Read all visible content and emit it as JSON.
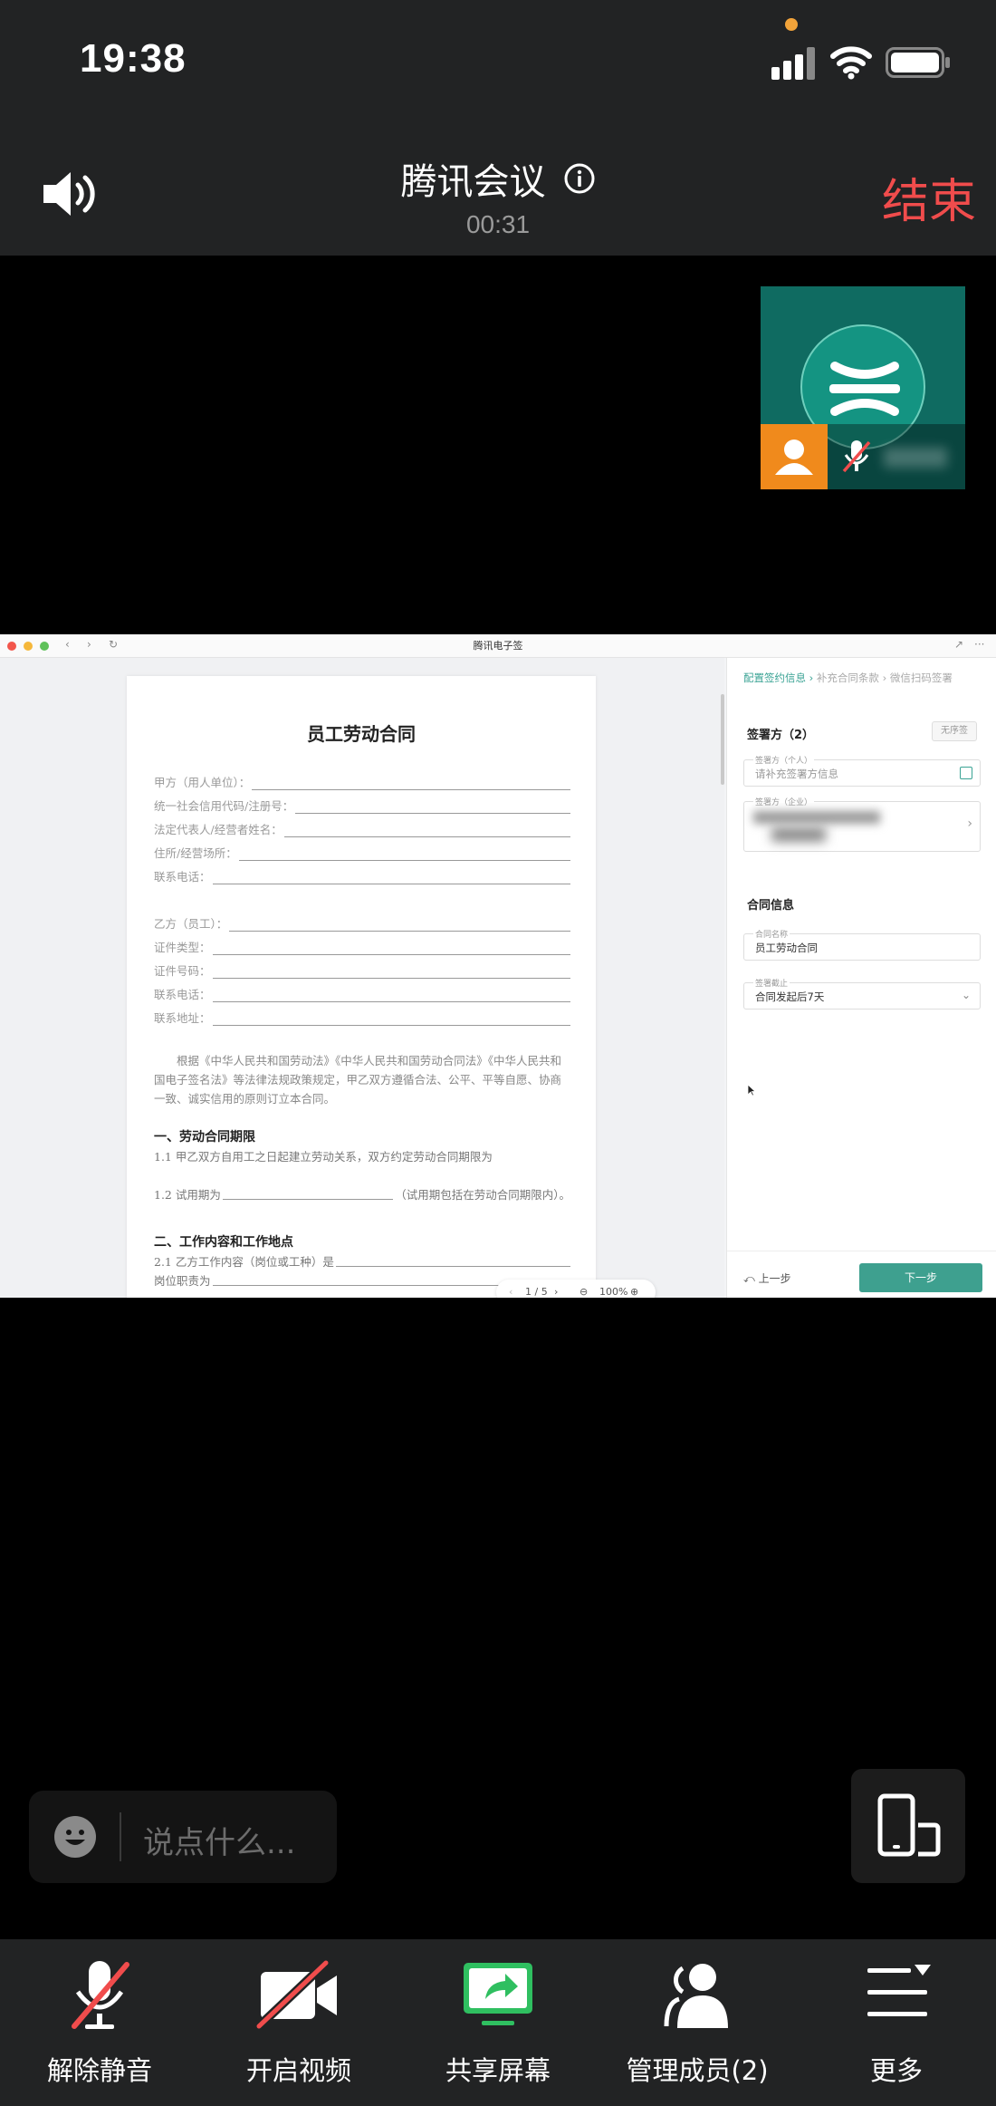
{
  "status_bar": {
    "time": "19:38",
    "icons": [
      "signal-icon",
      "wifi-icon",
      "battery-icon"
    ]
  },
  "header": {
    "title": "腾讯会议",
    "elapsed": "00:31",
    "end_label": "结束",
    "end_color": "#f04c4c"
  },
  "shared_screen": {
    "window_title": "腾讯电子签",
    "document": {
      "title": "员工劳动合同",
      "party_a_fields": [
        "甲方（用人单位）：",
        "统一社会信用代码/注册号：",
        "法定代表人/经营者姓名：",
        "住所/经营场所：",
        "联系电话："
      ],
      "party_b_fields": [
        "乙方（员工）：",
        "证件类型：",
        "证件号码：",
        "联系电话：",
        "联系地址："
      ],
      "preamble": "根据《中华人民共和国劳动法》《中华人民共和国劳动合同法》《中华人民共和国电子签名法》等法律法规政策规定，甲乙双方遵循合法、公平、平等自愿、协商一致、诚实信用的原则订立本合同。",
      "section1_title": "一、劳动合同期限",
      "clause_1_1": "1.1 甲乙双方自用工之日起建立劳动关系，双方约定劳动合同期限为",
      "clause_1_2_prefix": "1.2 试用期为",
      "clause_1_2_suffix": "（试用期包括在劳动合同期限内）。",
      "section2_title": "二、工作内容和工作地点",
      "clause_2_1": "2.1 乙方工作内容（岗位或工种）是",
      "clause_2_1b": "岗位职责为",
      "page_indicator": "1 / 5",
      "zoom": "100%"
    },
    "sidebar": {
      "breadcrumb": [
        "配置签约信息",
        "补充合同条款",
        "微信扫码签署"
      ],
      "signers_heading": "签署方（2）",
      "no_order_btn": "无序签",
      "personal_label": "签署方（个人）",
      "personal_placeholder": "请补充签署方信息",
      "enterprise_label": "签署方（企业）",
      "contract_info_heading": "合同信息",
      "contract_name_label": "合同名称",
      "contract_name_value": "员工劳动合同",
      "deadline_label": "签署截止",
      "deadline_value": "合同发起后7天",
      "back_label": "上一步",
      "next_label": "下一步",
      "accent_color": "#3ea08f"
    }
  },
  "chat": {
    "placeholder": "说点什么..."
  },
  "toolbar": {
    "items": [
      {
        "label": "解除静音",
        "icon": "mic-muted-icon"
      },
      {
        "label": "开启视频",
        "icon": "video-off-icon"
      },
      {
        "label": "共享屏幕",
        "icon": "share-screen-icon"
      },
      {
        "label": "管理成员(2)",
        "icon": "members-icon"
      },
      {
        "label": "更多",
        "icon": "more-menu-icon"
      }
    ],
    "share_color": "#2fbf60"
  }
}
